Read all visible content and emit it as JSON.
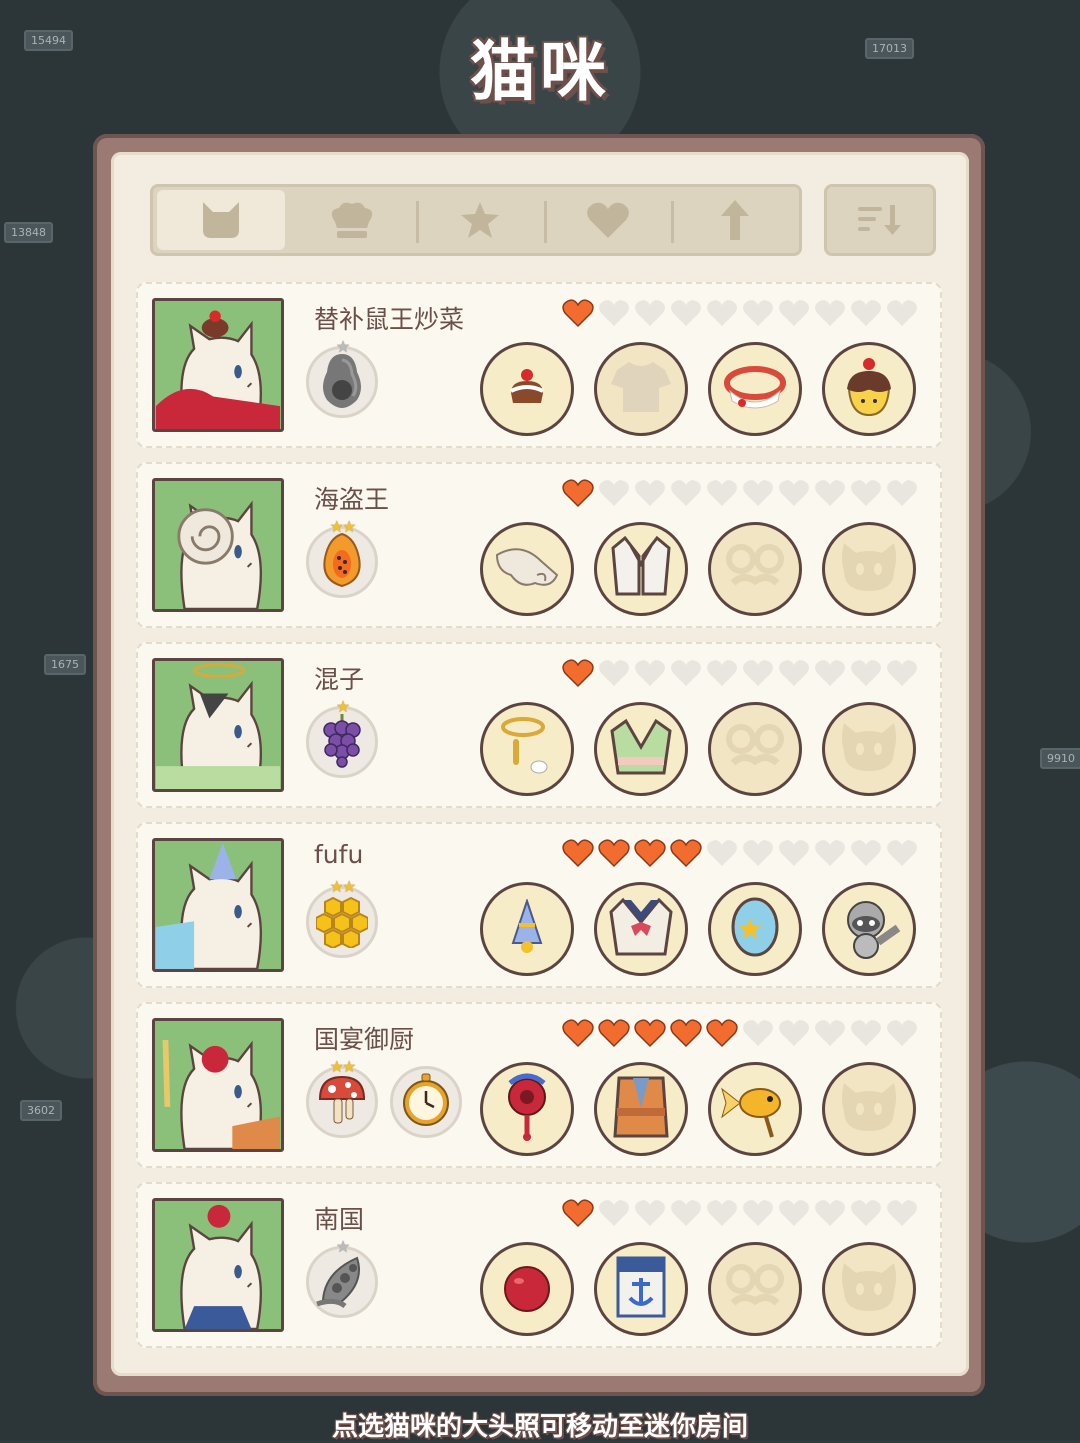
{
  "title": "猫咪",
  "footer_hint": "点选猫咪的大头照可移动至迷你房间",
  "tabs": [
    {
      "icon": "cat-head-icon",
      "active": true
    },
    {
      "icon": "chef-hat-icon",
      "active": false
    },
    {
      "icon": "star-icon",
      "active": false
    },
    {
      "icon": "heart-icon",
      "active": false
    },
    {
      "icon": "arrow-up-icon",
      "active": false
    }
  ],
  "sort_button": {
    "icon": "sort-descending-icon"
  },
  "colors": {
    "heart_filled": "#f26b2f",
    "heart_empty": "#e9e6e0",
    "portrait_bg": "#8bc07a"
  },
  "cats": [
    {
      "name": "替补鼠王炒菜",
      "hearts_filled": 1,
      "hearts_total": 10,
      "foods": [
        {
          "icon": "avocado-icon",
          "stars": 1,
          "star_color": "gray"
        }
      ],
      "outfits": [
        "cake-hat-icon",
        "shirt-silhouette-icon",
        "red-collar-icon",
        "pudding-icon"
      ]
    },
    {
      "name": "海盗王",
      "hearts_filled": 1,
      "hearts_total": 10,
      "foods": [
        {
          "icon": "papaya-icon",
          "stars": 2,
          "star_color": "gold"
        }
      ],
      "outfits": [
        "shell-hat-icon",
        "vest-icon",
        "glasses-silhouette-icon",
        "pet-silhouette-icon"
      ]
    },
    {
      "name": "混子",
      "hearts_filled": 1,
      "hearts_total": 10,
      "foods": [
        {
          "icon": "grapes-icon",
          "stars": 1,
          "star_color": "gold"
        }
      ],
      "outfits": [
        "halo-icon",
        "green-robe-icon",
        "glasses-silhouette-icon",
        "pet-silhouette-icon"
      ]
    },
    {
      "name": "fufu",
      "hearts_filled": 4,
      "hearts_total": 10,
      "foods": [
        {
          "icon": "honeycomb-icon",
          "stars": 2,
          "star_color": "gold"
        }
      ],
      "outfits": [
        "party-hat-icon",
        "sailor-uniform-icon",
        "star-badge-icon",
        "raccoon-pet-icon"
      ]
    },
    {
      "name": "国宴御厨",
      "hearts_filled": 5,
      "hearts_total": 10,
      "foods": [
        {
          "icon": "mushroom-icon",
          "stars": 2,
          "star_color": "gold"
        },
        {
          "icon": "pocket-watch-icon",
          "stars": 0,
          "star_color": "gold"
        }
      ],
      "outfits": [
        "flower-headpiece-icon",
        "kimono-icon",
        "goldfish-fan-icon",
        "pet-silhouette-icon"
      ]
    },
    {
      "name": "南国",
      "hearts_filled": 1,
      "hearts_total": 10,
      "foods": [
        {
          "icon": "peas-icon",
          "stars": 1,
          "star_color": "gray"
        }
      ],
      "outfits": [
        "cherry-hat-icon",
        "anchor-shirt-icon",
        "glasses-silhouette-icon",
        "pet-silhouette-icon"
      ]
    }
  ]
}
